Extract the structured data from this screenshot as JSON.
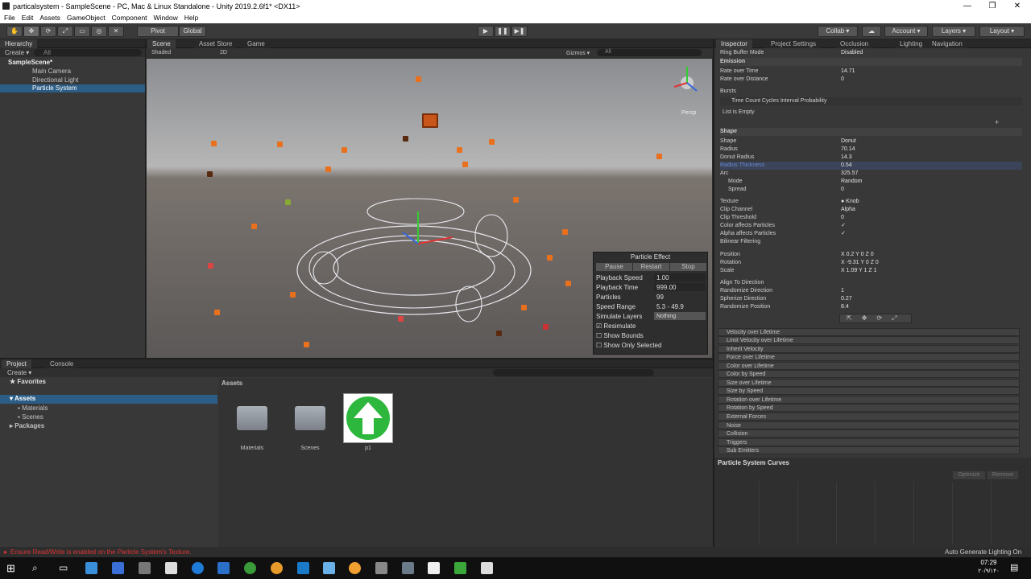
{
  "window": {
    "title": "particalsystem - SampleScene - PC, Mac & Linux Standalone - Unity 2019.2.6f1* <DX11>",
    "min": "—",
    "max": "❐",
    "close": "✕"
  },
  "menu": [
    "File",
    "Edit",
    "Assets",
    "GameObject",
    "Component",
    "Window",
    "Help"
  ],
  "toolbar": {
    "pivot": "Pivot",
    "global": "Global",
    "collab": "Collab ▾",
    "account": "Account ▾",
    "layers": "Layers ▾",
    "layout": "Layout ▾",
    "play": "▶",
    "pause": "❚❚",
    "step": "▶❚"
  },
  "hierarchy": {
    "tab": "Hierarchy",
    "create": "Create ▾",
    "search": "All",
    "scene": "SampleScene*",
    "items": [
      "Main Camera",
      "Directional Light",
      "Particle System"
    ]
  },
  "scene": {
    "tabs": [
      "Scene",
      "Asset Store",
      "Game"
    ],
    "shaded": "Shaded",
    "mode2d": "2D",
    "gizmos": "Gizmos ▾",
    "search": "All",
    "persp": "Persp"
  },
  "particle_effect": {
    "title": "Particle Effect",
    "pause": "Pause",
    "restart": "Restart",
    "stop": "Stop",
    "playback_speed_label": "Playback Speed",
    "playback_speed": "1.00",
    "playback_time_label": "Playback Time",
    "playback_time": "999.00",
    "particles_label": "Particles",
    "particles": "99",
    "speed_range_label": "Speed Range",
    "speed_range": "5.3 - 49.9",
    "simulate_layers_label": "Simulate Layers",
    "simulate_layers": "Nothing",
    "resimulate": "Resimulate",
    "show_bounds": "Show Bounds",
    "show_only_selected": "Show Only Selected"
  },
  "project": {
    "tabs": [
      "Project",
      "Console"
    ],
    "create": "Create ▾",
    "favorites": "Favorites",
    "assets": "Assets",
    "materials": "Materials",
    "scenes": "Scenes",
    "packages": "Packages",
    "breadcrumb": "Assets",
    "items": [
      "Materials",
      "Scenes",
      "p1"
    ]
  },
  "inspector": {
    "tabs": [
      "Inspector",
      "Project Settings",
      "Occlusion",
      "Lighting",
      "Navigation"
    ],
    "rows": [
      {
        "k": "Ring Buffer Mode",
        "v": "Disabled"
      },
      {
        "k": "Emission",
        "v": ""
      },
      {
        "k": "Rate over Time",
        "v": "14.71"
      },
      {
        "k": "Rate over Distance",
        "v": "0"
      },
      {
        "k": "Bursts",
        "v": ""
      },
      {
        "k": "Time    Count    Cycles    Interval    Probability",
        "v": ""
      },
      {
        "k": "List is Empty",
        "v": ""
      },
      {
        "k": "Shape",
        "v": ""
      },
      {
        "k": "Shape",
        "v": "Donut"
      },
      {
        "k": "Radius",
        "v": "70.14"
      },
      {
        "k": "Donut Radius",
        "v": "14.3"
      },
      {
        "k": "Radius Thickness",
        "v": "0.54"
      },
      {
        "k": "Arc",
        "v": "325.57"
      },
      {
        "k": "Mode",
        "v": "Random"
      },
      {
        "k": "Spread",
        "v": "0"
      },
      {
        "k": "Texture",
        "v": "● Knob"
      },
      {
        "k": "Clip Channel",
        "v": "Alpha"
      },
      {
        "k": "Clip Threshold",
        "v": "0"
      },
      {
        "k": "Color affects Particles",
        "v": "✓"
      },
      {
        "k": "Alpha affects Particles",
        "v": "✓"
      },
      {
        "k": "Bilinear Filtering",
        "v": ""
      },
      {
        "k": "Position",
        "v": "X 0.2      Y 0      Z 0"
      },
      {
        "k": "Rotation",
        "v": "X -9.31    Y 0      Z 0"
      },
      {
        "k": "Scale",
        "v": "X 1.09     Y 1      Z 1"
      },
      {
        "k": "Align To Direction",
        "v": ""
      },
      {
        "k": "Randomize Direction",
        "v": "1"
      },
      {
        "k": "Spherize Direction",
        "v": "0.27"
      },
      {
        "k": "Randomize Position",
        "v": "8.4"
      }
    ],
    "modules": [
      "Velocity over Lifetime",
      "Limit Velocity over Lifetime",
      "Inherit Velocity",
      "Force over Lifetime",
      "Color over Lifetime",
      "Color by Speed",
      "Size over Lifetime",
      "Size by Speed",
      "Rotation over Lifetime",
      "Rotation by Speed",
      "External Forces",
      "Noise",
      "Collision",
      "Triggers",
      "Sub Emitters"
    ]
  },
  "curves": {
    "title": "Particle System Curves",
    "optimize": "Optimize",
    "remove": "Remove"
  },
  "status": {
    "error": "Ensure Read/Write is enabled on the Particle System's Texture.",
    "right": "Auto Generate Lighting On"
  },
  "clock": {
    "time": "07:29",
    "date": "۲۰/۹/۱۴۰"
  }
}
